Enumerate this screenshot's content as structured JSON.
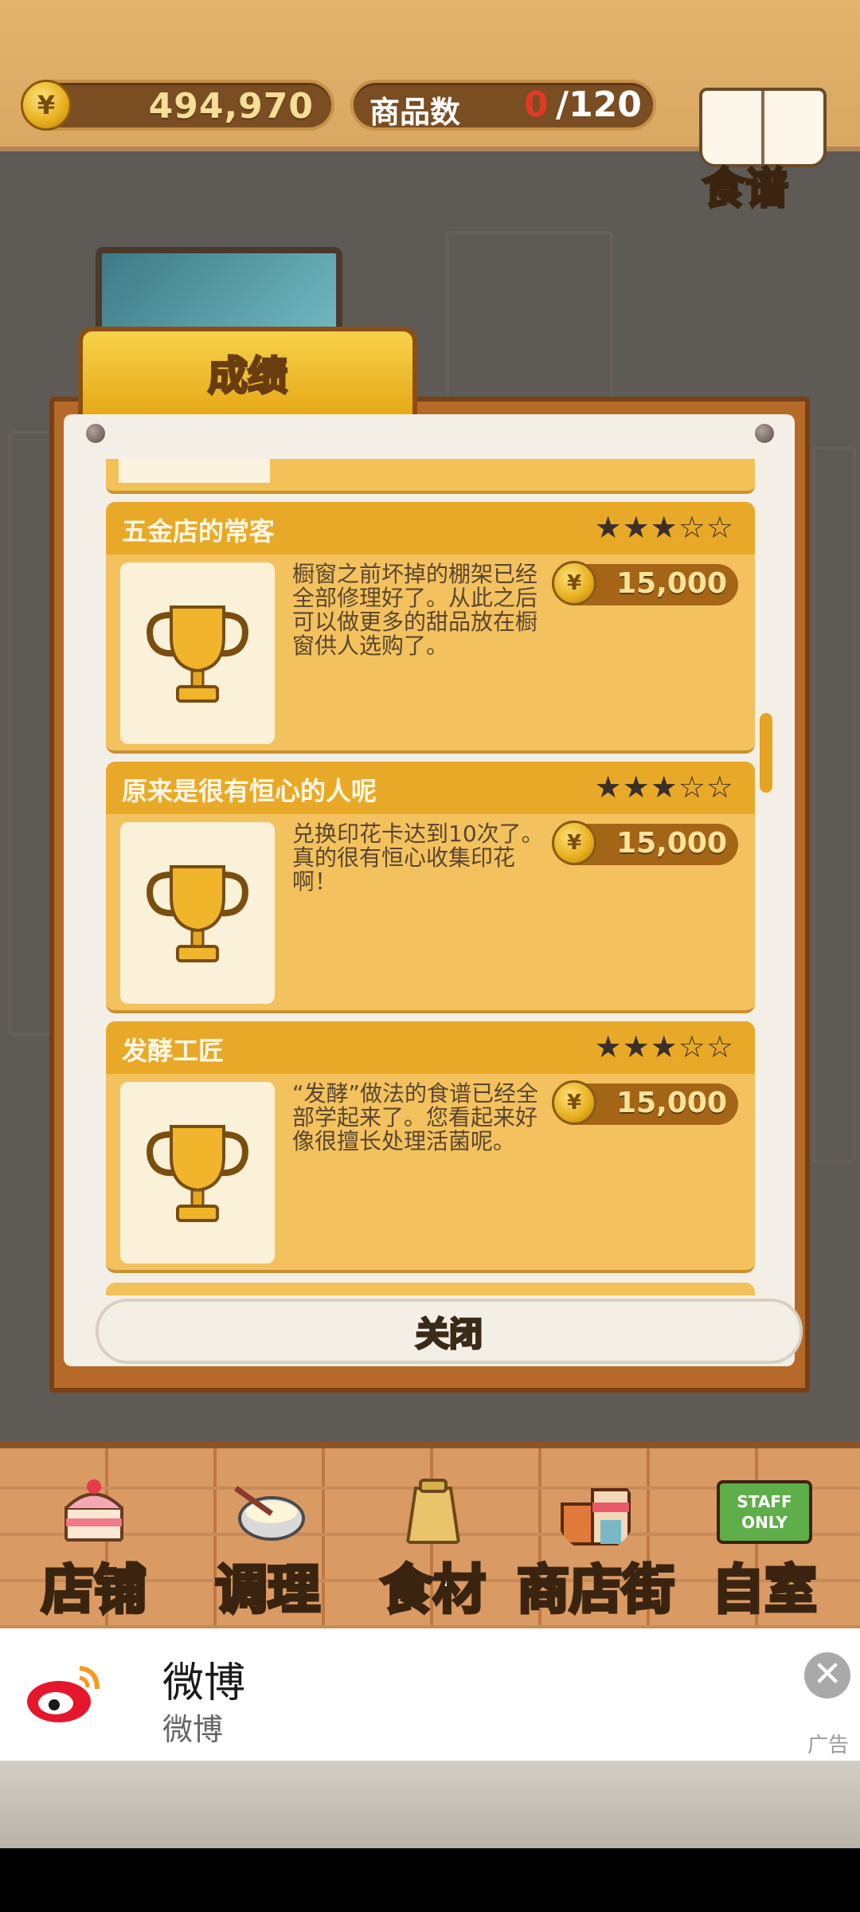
{
  "top_bar": {
    "coin_symbol": "¥",
    "money": "494,970",
    "product_count_label": "商品数",
    "product_count_current": "0",
    "product_count_total": "/120",
    "recipe_label": "食谱"
  },
  "dialog": {
    "tab_title": "成绩",
    "close_label": "关闭",
    "achievements": [
      {
        "title": "五金店的常客",
        "stars": "★★★☆☆",
        "description": "橱窗之前坏掉的棚架已经全部修理好了。从此之后可以做更多的甜品放在橱窗供人选购了。",
        "reward": "15,000"
      },
      {
        "title": "原来是很有恒心的人呢",
        "stars": "★★★☆☆",
        "description": "兑换印花卡达到10次了。真的很有恒心收集印花啊！",
        "reward": "15,000"
      },
      {
        "title": "发酵工匠",
        "stars": "★★★☆☆",
        "description": "“发酵”做法的食谱已经全部学起来了。您看起来好像很擅长处理活菌呢。",
        "reward": "15,000"
      }
    ]
  },
  "bottom_nav": {
    "items": [
      {
        "label": "店铺",
        "icon": "cake-icon"
      },
      {
        "label": "调理",
        "icon": "mixing-bowl-icon"
      },
      {
        "label": "食材",
        "icon": "flour-sack-icon"
      },
      {
        "label": "商店街",
        "icon": "shop-street-icon"
      },
      {
        "label": "自室",
        "icon": "staff-only-sign-icon"
      }
    ],
    "staff_sign_text": "STAFF ONLY"
  },
  "ad": {
    "title": "微博",
    "subtitle": "微博",
    "tag": "广告",
    "close_symbol": "✕"
  },
  "colors": {
    "accent_gold": "#e9a928",
    "card_bg": "#f3c25e",
    "frame_brown": "#b56a2a",
    "count_red": "#e03a26"
  }
}
